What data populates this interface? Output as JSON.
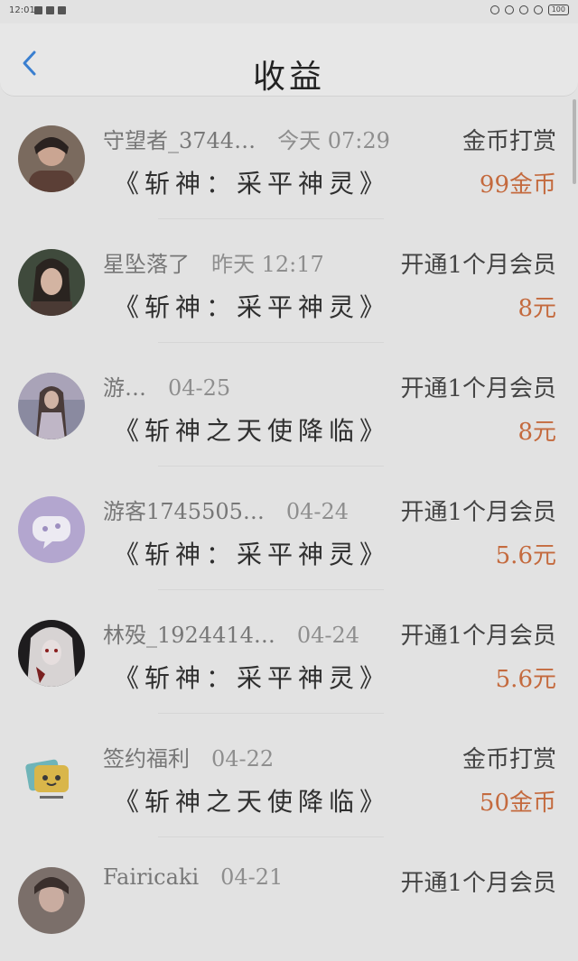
{
  "status": {
    "time": "12:01",
    "battery": "100"
  },
  "header": {
    "title": "收益"
  },
  "items": [
    {
      "user": "守望者_3744…",
      "time": "今天 07:29",
      "type": "金币打赏",
      "book": "《斩神：采平神灵》",
      "amount": "99金币"
    },
    {
      "user": "星坠落了",
      "time": "昨天 12:17",
      "type": "开通1个月会员",
      "book": "《斩神：采平神灵》",
      "amount": "8元"
    },
    {
      "user": "游…",
      "time": "04-25",
      "type": "开通1个月会员",
      "book": "《斩神之天使降临》",
      "amount": "8元"
    },
    {
      "user": "游客1745505…",
      "time": "04-24",
      "type": "开通1个月会员",
      "book": "《斩神：采平神灵》",
      "amount": "5.6元"
    },
    {
      "user": "林殁_1924414…",
      "time": "04-24",
      "type": "开通1个月会员",
      "book": "《斩神：采平神灵》",
      "amount": "5.6元"
    },
    {
      "user": "签约福利",
      "time": "04-22",
      "type": "金币打赏",
      "book": "《斩神之天使降临》",
      "amount": "50金币"
    },
    {
      "user": "Fairicaki",
      "time": "04-21",
      "type": "开通1个月会员",
      "book": "",
      "amount": ""
    }
  ]
}
